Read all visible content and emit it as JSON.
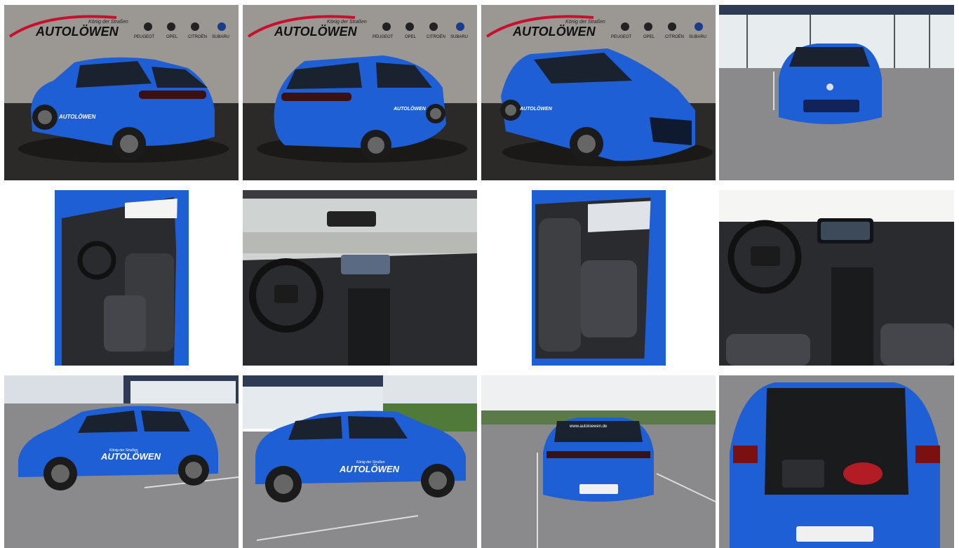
{
  "gallery": {
    "brand": {
      "tagline": "König der Straßen",
      "name": "AUTOLÖWEN",
      "makes": [
        "PEUGEOT",
        "OPEL",
        "CITROËN",
        "SUBARU"
      ]
    },
    "car_decal": {
      "tagline": "König der Straßen",
      "name": "AUTOLÖWEN",
      "url": "www.autoloewen.de"
    },
    "photos": [
      {
        "view": "studio-rear-three-quarter-left"
      },
      {
        "view": "studio-rear-three-quarter-right"
      },
      {
        "view": "studio-front-three-quarter"
      },
      {
        "view": "outdoor-front"
      },
      {
        "view": "interior-driver-door-open"
      },
      {
        "view": "interior-dashboard"
      },
      {
        "view": "interior-rear-seats"
      },
      {
        "view": "interior-cockpit-closeup"
      },
      {
        "view": "outdoor-side-left"
      },
      {
        "view": "outdoor-side-right"
      },
      {
        "view": "outdoor-rear"
      },
      {
        "view": "outdoor-open-trunk"
      }
    ],
    "colors": {
      "car_blue": "#1e5fd6",
      "car_blue_dark": "#0f3a9a",
      "studio_wall": "#9b9893",
      "studio_floor": "#2b2a28",
      "asphalt": "#8a8a8c",
      "interior": "#2a2b2e",
      "logo_red": "#c8102e"
    }
  }
}
